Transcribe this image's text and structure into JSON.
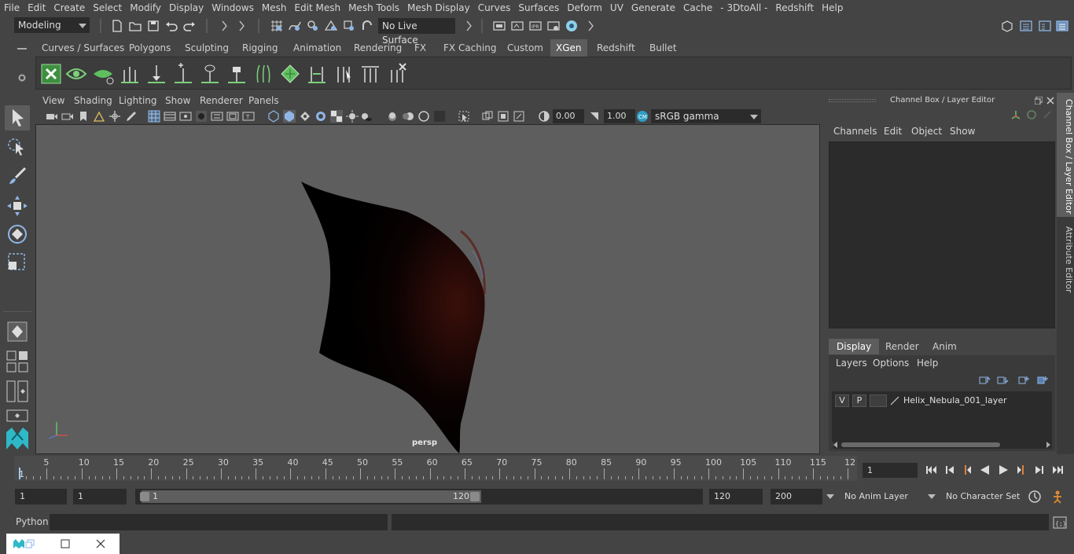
{
  "menubar": {
    "items": [
      "File",
      "Edit",
      "Create",
      "Select",
      "Modify",
      "Display",
      "Windows",
      "Mesh",
      "Edit Mesh",
      "Mesh Tools",
      "Mesh Display",
      "Curves",
      "Surfaces",
      "Deform",
      "UV",
      "Generate",
      "Cache",
      "- 3DtoAll -",
      "Redshift",
      "Help"
    ]
  },
  "statusline": {
    "mode": "Modeling",
    "live_surface": "No Live Surface"
  },
  "shelf": {
    "tabs": [
      "Curves / Surfaces",
      "Polygons",
      "Sculpting",
      "Rigging",
      "Animation",
      "Rendering",
      "FX",
      "FX Caching",
      "Custom",
      "XGen",
      "Redshift",
      "Bullet"
    ],
    "active_tab": "XGen"
  },
  "viewport": {
    "menu": [
      "View",
      "Shading",
      "Lighting",
      "Show",
      "Renderer",
      "Panels"
    ],
    "exposure": "0.00",
    "gamma": "1.00",
    "color_space": "sRGB gamma",
    "camera_label": "persp"
  },
  "channelbox": {
    "title": "Channel Box / Layer Editor",
    "menu": [
      "Channels",
      "Edit",
      "Object",
      "Show"
    ]
  },
  "layers": {
    "tabs": [
      "Display",
      "Render",
      "Anim"
    ],
    "active_tab": "Display",
    "menu": [
      "Layers",
      "Options",
      "Help"
    ],
    "row": {
      "visible": "V",
      "playback": "P",
      "name": "Helix_Nebula_001_layer"
    }
  },
  "sidetabs": [
    "Channel Box / Layer Editor",
    "Attribute Editor"
  ],
  "timeline": {
    "ticks": [
      "5",
      "10",
      "15",
      "20",
      "25",
      "30",
      "35",
      "40",
      "45",
      "50",
      "55",
      "60",
      "65",
      "70",
      "75",
      "80",
      "85",
      "90",
      "95",
      "100",
      "105",
      "110",
      "115",
      "12"
    ],
    "start_label": "1",
    "current_frame": "1"
  },
  "range": {
    "start": "1",
    "inner_start": "1",
    "slider_start": "1",
    "slider_end": "120",
    "end": "120",
    "anim_end": "200",
    "anim_layer": "No Anim Layer",
    "character_set": "No Character Set"
  },
  "python": {
    "label": "Python"
  },
  "colors": {
    "bg": "#444444",
    "viewport": "#5e5e5e",
    "field": "#2b2b2b",
    "accent": "#5d5d5d"
  }
}
